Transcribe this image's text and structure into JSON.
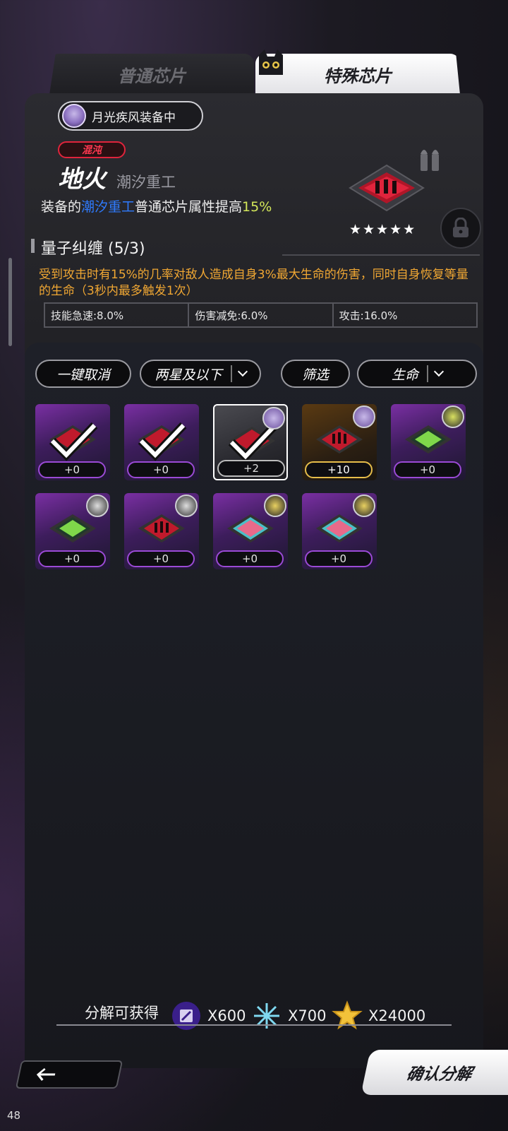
{
  "tabs": {
    "normal": "普通芯片",
    "special": "特殊芯片"
  },
  "equip": {
    "label": "月光疾风装备中"
  },
  "chip": {
    "rarity": "混沌",
    "name": "地火",
    "brand": "潮汐重工",
    "bonus_prefix": "装备的",
    "bonus_brand": "潮汐重工",
    "bonus_mid": "普通芯片属性提高",
    "bonus_value": "15%",
    "stars": "★★★★★"
  },
  "set": {
    "title": "量子纠缠 (5/3)",
    "description": "受到攻击时有15%的几率对敌人造成自身3%最大生命的伤害，同时自身恢复等量的生命（3秒内最多触发1次）"
  },
  "stats": [
    {
      "label": "技能急速:8.0%"
    },
    {
      "label": "伤害减免:6.0%"
    },
    {
      "label": "攻击:16.0%"
    }
  ],
  "filters": {
    "cancel_all": "一键取消",
    "star_filter": "两星及以下",
    "filter": "筛选",
    "sort": "生命"
  },
  "cards": [
    {
      "level": "+0"
    },
    {
      "level": "+0"
    },
    {
      "level": "+2"
    },
    {
      "level": "+10"
    },
    {
      "level": "+0"
    },
    {
      "level": "+0"
    },
    {
      "level": "+0"
    },
    {
      "level": "+0"
    },
    {
      "level": "+0"
    }
  ],
  "rewards": {
    "label": "分解可获得",
    "items": [
      {
        "icon": "purple-chip-icon",
        "amount": "X600"
      },
      {
        "icon": "crystal-icon",
        "amount": "X700"
      },
      {
        "icon": "gold-star-icon",
        "amount": "X24000"
      }
    ]
  },
  "buttons": {
    "back": "←",
    "confirm": "确认分解"
  },
  "fps": "48",
  "colors": {
    "rarity": "#e0243c",
    "brand_highlight": "#2f7bff",
    "bonus_value": "#d4e85a",
    "set_desc": "#f0a733"
  }
}
